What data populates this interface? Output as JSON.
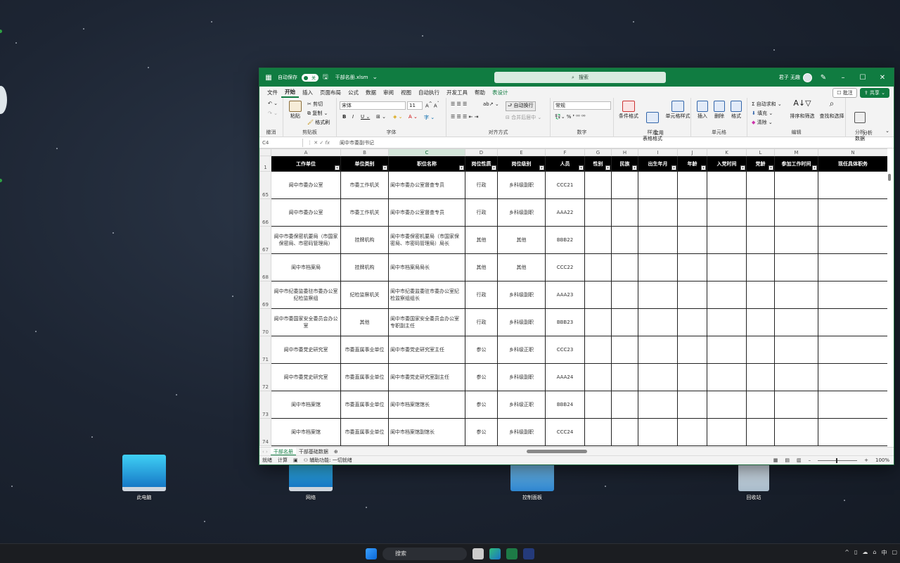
{
  "desktop": {
    "icons": [
      {
        "label": "此电脑",
        "icon": "computer-icon"
      },
      {
        "label": "网络",
        "icon": "network-icon"
      },
      {
        "label": "控制面板",
        "icon": "control-panel-icon"
      },
      {
        "label": "回收站",
        "icon": "recycle-bin-icon"
      }
    ]
  },
  "titlebar": {
    "autosave_label": "自动保存",
    "autosave_state": "关",
    "filename": "干部名册.xlsm",
    "search_placeholder": "搜索",
    "user": "君子 无趣"
  },
  "menu": {
    "items": [
      "文件",
      "开始",
      "插入",
      "页面布局",
      "公式",
      "数据",
      "审阅",
      "视图",
      "自动执行",
      "开发工具",
      "帮助",
      "表设计"
    ],
    "comment": "批注",
    "share": "共享"
  },
  "ribbon": {
    "undo_group": "撤消",
    "clipboard": {
      "group": "剪贴板",
      "paste": "粘贴",
      "cut": "剪切",
      "copy": "复制",
      "format_painter": "格式刷"
    },
    "font": {
      "group": "字体",
      "name": "宋体",
      "size": "11"
    },
    "alignment": {
      "group": "对齐方式",
      "wrap": "自动换行",
      "merge": "合并后居中"
    },
    "number": {
      "group": "数字",
      "format": "常规"
    },
    "styles": {
      "group": "样式",
      "conditional": "条件格式",
      "table": "套用\n表格格式",
      "cell": "单元格样式"
    },
    "cells": {
      "group": "单元格",
      "insert": "插入",
      "delete": "删除",
      "format": "格式"
    },
    "editing": {
      "group": "编辑",
      "autosum": "自动求和",
      "fill": "填充",
      "clear": "清除",
      "sort": "排序和筛选",
      "find": "查找和选择"
    },
    "analysis": {
      "group": "分析",
      "analyze": "分析\n数据"
    }
  },
  "formula_bar": {
    "cell": "C4",
    "fx": "fx",
    "content": "阆中市委副书记"
  },
  "columns": [
    "A",
    "B",
    "C",
    "D",
    "E",
    "F",
    "G",
    "H",
    "I",
    "J",
    "K",
    "L",
    "M",
    "N"
  ],
  "selected_column": "C",
  "headers": [
    "工作单位",
    "单位类别",
    "职位名称",
    "岗位性质",
    "岗位级别",
    "人员",
    "性别",
    "民族",
    "出生年月",
    "年龄",
    "入党时间",
    "党龄",
    "参加工作时间",
    "现任具体职务"
  ],
  "rows": [
    {
      "n": "65",
      "a": "阆中市委办公室",
      "b": "市委工作机关",
      "c": "阆中市委办公室督查专员",
      "d": "行政",
      "e": "乡科级副职",
      "f": "CCC21"
    },
    {
      "n": "66",
      "a": "阆中市委办公室",
      "b": "市委工作机关",
      "c": "阆中市委办公室督查专员",
      "d": "行政",
      "e": "乡科级副职",
      "f": "AAA22"
    },
    {
      "n": "67",
      "a": "阆中市委保密机要局（市国家保密局、市密码管理局）",
      "b": "挂牌机构",
      "c": "阆中市委保密机要局（市国家保密局、市密码管理局）局长",
      "d": "其他",
      "e": "其他",
      "f": "BBB22"
    },
    {
      "n": "68",
      "a": "阆中市档案局",
      "b": "挂牌机构",
      "c": "阆中市档案局局长",
      "d": "其他",
      "e": "其他",
      "f": "CCC22"
    },
    {
      "n": "69",
      "a": "阆中市纪委监委驻市委办公室纪检监察组",
      "b": "纪检监察机关",
      "c": "阆中市纪委监委驻市委办公室纪检监察组组长",
      "d": "行政",
      "e": "乡科级副职",
      "f": "AAA23"
    },
    {
      "n": "70",
      "a": "阆中市委国家安全委员会办公室",
      "b": "其他",
      "c": "阆中市委国家安全委员会办公室专职副主任",
      "d": "行政",
      "e": "乡科级副职",
      "f": "BBB23"
    },
    {
      "n": "71",
      "a": "阆中市委党史研究室",
      "b": "市委直属事业单位",
      "c": "阆中市委党史研究室主任",
      "d": "参公",
      "e": "乡科级正职",
      "f": "CCC23"
    },
    {
      "n": "72",
      "a": "阆中市委党史研究室",
      "b": "市委直属事业单位",
      "c": "阆中市委党史研究室副主任",
      "d": "参公",
      "e": "乡科级副职",
      "f": "AAA24"
    },
    {
      "n": "73",
      "a": "阆中市档案馆",
      "b": "市委直属事业单位",
      "c": "阆中市档案馆馆长",
      "d": "参公",
      "e": "乡科级正职",
      "f": "BBB24"
    },
    {
      "n": "74",
      "a": "阆中市档案馆",
      "b": "市委直属事业单位",
      "c": "阆中市档案馆副馆长",
      "d": "参公",
      "e": "乡科级副职",
      "f": "CCC24"
    }
  ],
  "sheets": [
    "干部名册",
    "干部基础数据"
  ],
  "status": {
    "ready": "就绪",
    "calc": "计算",
    "accessibility": "辅助功能: 一切就绪",
    "zoom": "100%"
  },
  "taskbar": {
    "search": "搜索",
    "ime": "中"
  }
}
